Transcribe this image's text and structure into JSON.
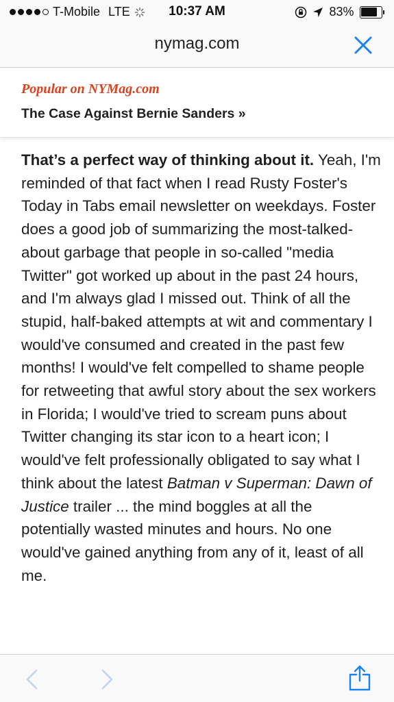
{
  "status_bar": {
    "carrier": "T-Mobile",
    "network": "LTE",
    "time": "10:37 AM",
    "battery_pct": "83%",
    "battery_level": 0.83,
    "signal_bars_filled": 4,
    "signal_bars_total": 5,
    "icons": [
      "signal-dots-icon",
      "loading-spinner-icon",
      "orientation-lock-icon",
      "location-arrow-icon",
      "battery-icon"
    ]
  },
  "url_bar": {
    "domain": "nymag.com",
    "close_icon": "close-x-icon",
    "accent_color": "#1a82f7"
  },
  "popular_banner": {
    "kicker": "Popular on NYMag.com",
    "headline": "The Case Against Bernie Sanders »",
    "kicker_color": "#d8431f"
  },
  "article": {
    "lead_bold": "That’s a perfect way of thinking about it.",
    "body_1": "Yeah, I'm reminded of that fact when I read Rusty Foster's Today in Tabs email newsletter on weekdays. Foster does a good job of summarizing the most-talked-about garbage that people in so-called \"media Twitter\" got worked up about in the past 24 hours, and I'm always glad I missed out. Think of all the stupid, half-baked attempts at wit and commentary I would've consumed and created in the past few months! I would've felt compelled to shame people for retweeting that awful story about the sex workers in Florida; I would've tried to scream puns about Twitter changing its star icon to a heart icon; I would've felt professionally obligated to say what I think about the latest",
    "italic_title": "Batman v Superman: Dawn of Justice",
    "body_2": "trailer ... the mind boggles at all the potentially wasted minutes and hours. No one would've gained anything from any of it, least of all me."
  },
  "toolbar": {
    "back_icon": "chevron-left-icon",
    "forward_icon": "chevron-right-icon",
    "share_icon": "share-icon",
    "nav_disabled_color": "#bcd6f5",
    "accent_color": "#1a82f7"
  }
}
